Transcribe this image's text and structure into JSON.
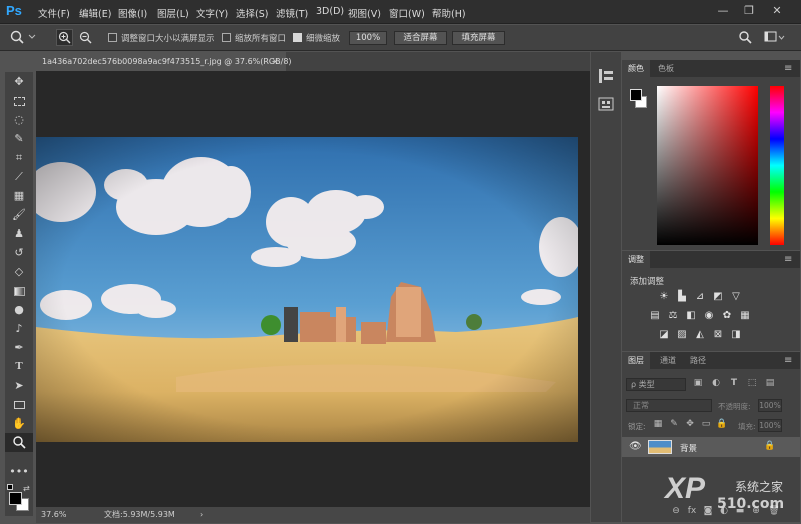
{
  "app": {
    "logo": "Ps"
  },
  "menu": [
    "文件(F)",
    "编辑(E)",
    "图像(I)",
    "图层(L)",
    "文字(Y)",
    "选择(S)",
    "滤镜(T)",
    "3D(D)",
    "视图(V)",
    "窗口(W)",
    "帮助(H)"
  ],
  "window_controls": {
    "minimize": "—",
    "restore": "❐",
    "close": "✕"
  },
  "options": {
    "resize_windows": "调整窗口大小以满屏显示",
    "zoom_all": "缩放所有窗口",
    "scrubby_zoom": "细微缩放",
    "zoom_value": "100%",
    "fit_screen": "适合屏幕",
    "fill_screen": "填充屏幕"
  },
  "document": {
    "tab_title": "1a436a702dec576b0098a9ac9f473515_r.jpg @ 37.6%(RGB/8)",
    "close": "×"
  },
  "status": {
    "zoom": "37.6%",
    "doc_info": "文档:5.93M/5.93M",
    "arrow": "›"
  },
  "panels": {
    "color_tabs": [
      "颜色",
      "色板"
    ],
    "adjust_tab": "调整",
    "adjust_add": "添加调整",
    "layers_tabs": [
      "图层",
      "通道",
      "路径"
    ],
    "layer_filter": "ρ 类型",
    "blend_mode": "正常",
    "opacity_label": "不透明度:",
    "opacity_value": "100%",
    "lock_label": "锁定:",
    "fill_label": "填充:",
    "fill_value": "100%",
    "layer_name": "背景"
  },
  "watermark": {
    "brand": "XP",
    "site": "510.com",
    "cn": "系统之家"
  },
  "colors": {
    "accent": "#31a8ff",
    "foreground": "#000000",
    "background": "#ffffff"
  }
}
